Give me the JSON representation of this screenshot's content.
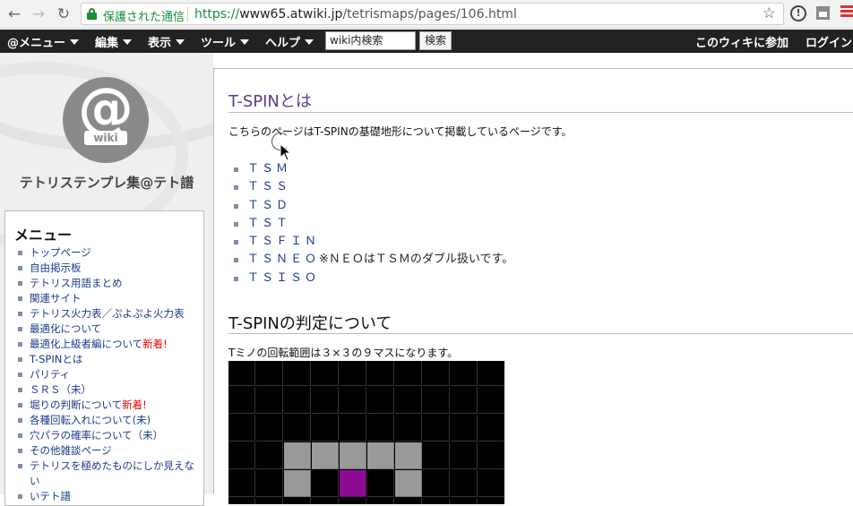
{
  "browser": {
    "secure_label": "保護された通信",
    "url_scheme": "https://",
    "url_host": "www65.atwiki.jp",
    "url_path": "/tetrismaps/pages/106.html"
  },
  "menubar": {
    "items": [
      "@メニュー",
      "編集",
      "表示",
      "ツール",
      "ヘルプ"
    ],
    "search_value": "wiki内検索",
    "search_button": "検索",
    "join": "このウィキに参加",
    "login": "ログイン"
  },
  "sidebar": {
    "logo_text": "@",
    "logo_sub": "wiki",
    "site_title": "テトリステンプレ集@テト譜",
    "menu_heading": "メニュー",
    "items": [
      {
        "label": "トップページ",
        "badge": ""
      },
      {
        "label": "自由掲示板",
        "badge": ""
      },
      {
        "label": "テトリス用語まとめ",
        "badge": ""
      },
      {
        "label": "関連サイト",
        "badge": ""
      },
      {
        "label": "テトリス火力表／ぷよぷよ火力表",
        "badge": ""
      },
      {
        "label": "最適化について",
        "badge": ""
      },
      {
        "label": "最適化上級者編について",
        "badge": "新着!"
      },
      {
        "label": "T-SPINとは",
        "badge": ""
      },
      {
        "label": "パリティ",
        "badge": ""
      },
      {
        "label": "ＳＲＳ（未）",
        "badge": ""
      },
      {
        "label": "堀りの判断について",
        "badge": "新着!"
      },
      {
        "label": "各種回転入れについて(未)",
        "badge": ""
      },
      {
        "label": "穴パラの確率について（未）",
        "badge": ""
      },
      {
        "label": "その他雑談ページ",
        "badge": ""
      },
      {
        "label": "テトリスを極めたものにしか見えない",
        "badge": ""
      },
      {
        "label": "いテト譜",
        "badge": ""
      }
    ]
  },
  "content": {
    "heading1": "T-SPINとは",
    "intro": "こちらのページはT-SPINの基礎地形について掲載しているページです。",
    "tspin_links": [
      {
        "link": "ＴＳＭ",
        "note": ""
      },
      {
        "link": "ＴＳＳ",
        "note": ""
      },
      {
        "link": "ＴＳＤ",
        "note": ""
      },
      {
        "link": "ＴＳＴ",
        "note": ""
      },
      {
        "link": "ＴＳＦＩＮ",
        "note": ""
      },
      {
        "link": "ＴＳＮＥＯ",
        "note": "※ＮＥＯはＴＳＭのダブル扱いです。"
      },
      {
        "link": "ＴＳＩＳＯ",
        "note": ""
      }
    ],
    "heading2": "T-SPINの判定について",
    "rotation_text": "Tミノの回転範囲は３×３の９マスになります。"
  },
  "colors": {
    "heading_purple": "#5a3d8a",
    "link_blue": "#1a3c8c",
    "new_red": "#e00000",
    "tmino_purple": "#8c0c94",
    "gray_block": "#999999"
  }
}
